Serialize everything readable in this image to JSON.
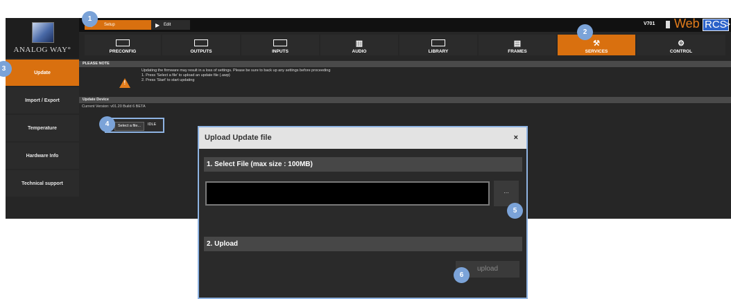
{
  "brand": {
    "logo_text": "ANALOG WAY°",
    "version": "V701",
    "web": "Web",
    "rcs": "RCS",
    "more": ">"
  },
  "top_tabs": [
    {
      "label": "Setup",
      "icon": "gear-icon"
    },
    {
      "label": "Edit",
      "icon": "play-icon"
    }
  ],
  "nav": [
    {
      "label": "PRECONFIG"
    },
    {
      "label": "OUTPUTS"
    },
    {
      "label": "INPUTS"
    },
    {
      "label": "AUDIO"
    },
    {
      "label": "LIBRARY"
    },
    {
      "label": "FRAMES"
    },
    {
      "label": "SERVICES",
      "active": true
    },
    {
      "label": "CONTROL"
    }
  ],
  "sidebar": {
    "items": [
      {
        "label": "Update",
        "active": true
      },
      {
        "label": "Import / Export"
      },
      {
        "label": "Temperature"
      },
      {
        "label": "Hardware Info"
      },
      {
        "label": "Technical support"
      }
    ]
  },
  "content": {
    "please_note": "PLEASE NOTE",
    "note_lines": [
      "Updating the firmware may result in a loss of settings. Please be sure to back up any settings before proceeding",
      "1. Press 'Select a file' to upload an update file (.awp)",
      "2. Press 'Start' to start updating"
    ],
    "update_device": "Update Device",
    "current_version": "Current Version: v01.20 Build 6 BETA",
    "select_file": "Select a file...",
    "status": "IDLE"
  },
  "dialog": {
    "title": "Upload Update file",
    "close": "×",
    "section1": "1. Select File (max size : 100MB)",
    "browse": "...",
    "section2": "2. Upload",
    "upload": "upload"
  },
  "callouts": [
    "1",
    "2",
    "3",
    "4",
    "5",
    "6"
  ],
  "colors": {
    "accent": "#d9700f",
    "callout": "#7ba3d8",
    "background": "#262626"
  }
}
